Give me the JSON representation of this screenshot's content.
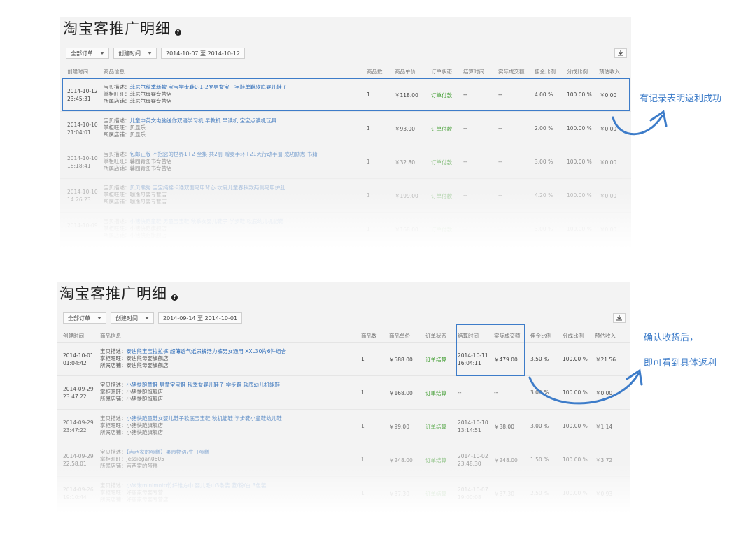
{
  "panel_top": {
    "title": "淘宝客推广明细",
    "help_icon": "?",
    "filters": {
      "order_type": "全部订单",
      "time_type": "创建时间",
      "date_range": "2014-10-07 至 2014-10-12"
    },
    "columns": [
      "创建时间",
      "商品信息",
      "商品数",
      "商品单价",
      "订单状态",
      "结算时间",
      "实际成交额",
      "佣金比例",
      "分成比例",
      "预估收入"
    ],
    "rows": [
      {
        "date": "2014-10-12",
        "time": "23:45:31",
        "desc_label": "宝贝描述：",
        "desc": "菲尼尔秋季新款 宝宝学步鞋0-1-2岁男女宝丁字鞋单鞋软底婴儿鞋子",
        "seller_label": "掌柜旺旺：",
        "seller": "菲尼尔母婴专营店",
        "shop_label": "所属店铺：",
        "shop": "菲尼尔母婴专营店",
        "qty": "1",
        "price": "￥118.00",
        "status": "订单付款",
        "settle_date": "--",
        "settle_time": "",
        "amount": "--",
        "commission": "4.00 %",
        "share": "100.00 %",
        "income": "￥0.00"
      },
      {
        "date": "2014-10-10",
        "time": "21:04:01",
        "desc_label": "宝贝描述：",
        "desc": "儿童中英文电脑送你双语学习机 早教机 早读机 宝宝点读机玩具",
        "seller_label": "掌柜旺旺：",
        "seller": "贝显乐",
        "shop_label": "所属店铺：",
        "shop": "贝显乐",
        "qty": "1",
        "price": "￥93.00",
        "status": "订单付款",
        "settle_date": "--",
        "settle_time": "",
        "amount": "--",
        "commission": "2.00 %",
        "share": "100.00 %",
        "income": "￥0.00"
      },
      {
        "date": "2014-10-10",
        "time": "18:18:41",
        "desc_label": "宝贝描述：",
        "desc": "包邮正版 不抱怨的世界1+2 全集 共2册 赠麦手环+21天行动手册 成功励志 书籍",
        "seller_label": "掌柜旺旺：",
        "seller": "馨园青图书专营店",
        "shop_label": "所属店铺：",
        "shop": "馨园青图书专营店",
        "qty": "1",
        "price": "￥32.80",
        "status": "订单付款",
        "settle_date": "--",
        "settle_time": "",
        "amount": "--",
        "commission": "3.00 %",
        "share": "100.00 %",
        "income": "￥0.00"
      },
      {
        "date": "2014-10-10",
        "time": "14:26:23",
        "desc_label": "宝贝描述：",
        "desc": "贝贝熊秀 宝宝纯棉卡通双面马甲背心 坎肩儿童春秋款两侧马甲护肚",
        "seller_label": "掌柜旺旺：",
        "seller": "咖逸母婴专营店",
        "shop_label": "所属店铺：",
        "shop": "咖逸母婴专营店",
        "qty": "1",
        "price": "￥199.00",
        "status": "订单付款",
        "settle_date": "--",
        "settle_time": "",
        "amount": "--",
        "commission": "4.20 %",
        "share": "100.00 %",
        "income": "￥0.00"
      },
      {
        "date": "2014-10-09",
        "time": "",
        "desc_label": "宝贝描述：",
        "desc": "小猪快跑童鞋 男童宝宝鞋 秋季女婴儿鞋子 学步鞋 软底幼儿机能鞋",
        "seller_label": "掌柜旺旺：",
        "seller": "小猪快跑旗舰店",
        "shop_label": "所属店铺：",
        "shop": "小猪快跑旗舰店",
        "qty": "1",
        "price": "￥168.00",
        "status": "订单付款",
        "settle_date": "--",
        "settle_time": "",
        "amount": "--",
        "commission": "3.00 %",
        "share": "100.00 %",
        "income": "￥0.00"
      }
    ]
  },
  "panel_bottom": {
    "title": "淘宝客推广明细",
    "help_icon": "?",
    "filters": {
      "order_type": "全部订单",
      "time_type": "创建时间",
      "date_range": "2014-09-14 至 2014-10-01"
    },
    "columns": [
      "创建时间",
      "商品信息",
      "商品数",
      "商品单价",
      "订单状态",
      "结算时间",
      "实际成交额",
      "佣金比例",
      "分成比例",
      "预估收入"
    ],
    "rows": [
      {
        "date": "2014-10-01",
        "time": "01:04:42",
        "desc_label": "宝贝描述：",
        "desc": "泰迪熊宝宝拉拉裤 超薄透气纸尿裤活力裤男女通用 XXL30片6件组合",
        "seller_label": "掌柜旺旺：",
        "seller": "泰迪熊母婴旗舰店",
        "shop_label": "所属店铺：",
        "shop": "泰迪熊母婴旗舰店",
        "qty": "1",
        "price": "￥588.00",
        "status": "订单结算",
        "settle_date": "2014-10-11",
        "settle_time": "16:04:11",
        "amount": "￥479.00",
        "commission": "3.50 %",
        "share": "100.00 %",
        "income": "￥21.56"
      },
      {
        "date": "2014-09-29",
        "time": "23:47:22",
        "desc_label": "宝贝描述：",
        "desc": "小猪快跑童鞋 男童宝宝鞋 秋季女婴儿鞋子 学步鞋 软底幼儿机能鞋",
        "seller_label": "掌柜旺旺：",
        "seller": "小猪快跑旗舰店",
        "shop_label": "所属店铺：",
        "shop": "小猪快跑旗舰店",
        "qty": "1",
        "price": "￥168.00",
        "status": "订单结算",
        "settle_date": "--",
        "settle_time": "",
        "amount": "--",
        "commission": "3.00 %",
        "share": "100.00 %",
        "income": "￥0.00"
      },
      {
        "date": "2014-09-29",
        "time": "23:47:22",
        "desc_label": "宝贝描述：",
        "desc": "小猪快跑童鞋女婴儿鞋子软底宝宝鞋 秋机能鞋 学步鞋小童鞋幼儿鞋",
        "seller_label": "掌柜旺旺：",
        "seller": "小猪快跑旗舰店",
        "shop_label": "所属店铺：",
        "shop": "小猪快跑旗舰店",
        "qty": "1",
        "price": "￥99.00",
        "status": "订单结算",
        "settle_date": "2014-10-10",
        "settle_time": "13:14:51",
        "amount": "￥38.00",
        "commission": "3.00 %",
        "share": "100.00 %",
        "income": "￥1.14"
      },
      {
        "date": "2014-09-29",
        "time": "22:58:01",
        "desc_label": "宝贝描述：",
        "desc": "【吉西家的蛋糕】果园物语/生日蛋糕",
        "seller_label": "掌柜旺旺：",
        "seller": "jessiegan0605",
        "shop_label": "所属店铺：",
        "shop": "吉西家的蛋糕",
        "qty": "1",
        "price": "￥248.00",
        "status": "订单结算",
        "settle_date": "2014-10-02",
        "settle_time": "23:48:30",
        "amount": "￥248.00",
        "commission": "1.50 %",
        "share": "100.00 %",
        "income": "￥3.72"
      },
      {
        "date": "2014-09-26",
        "time": "19:10:44",
        "desc_label": "宝贝描述：",
        "desc": "小米米minimoto竹纤维方巾 婴儿毛巾3条装 蓝/粉/白 3色装",
        "seller_label": "掌柜旺旺：",
        "seller": "好丽家母婴专营",
        "shop_label": "所属店铺：",
        "shop": "好丽家母婴专营店",
        "qty": "1",
        "price": "￥37.30",
        "status": "订单结算",
        "settle_date": "2014-10-07",
        "settle_time": "19:00:08",
        "amount": "￥37.30",
        "commission": "2.50 %",
        "share": "100.00 %",
        "income": "￥0.93"
      }
    ]
  },
  "annotations": {
    "note_top": "有记录表明返利成功",
    "note_bottom_line1": "确认收货后，",
    "note_bottom_line2": "即可看到具体返利",
    "accent_color": "#3d7cc9"
  }
}
